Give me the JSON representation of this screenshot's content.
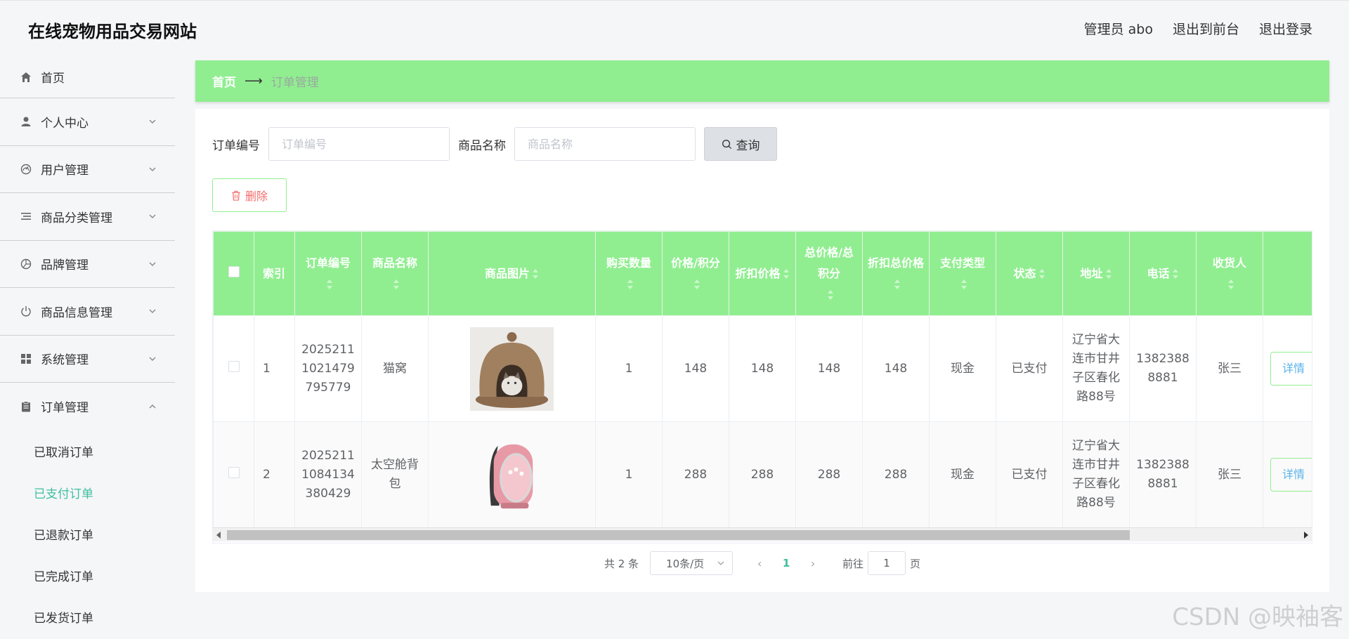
{
  "header": {
    "site_title": "在线宠物用品交易网站",
    "admin_label": "管理员 abo",
    "to_front_label": "退出到前台",
    "logout_label": "退出登录"
  },
  "sidebar": {
    "items": [
      {
        "label": "首页",
        "icon": "home-icon"
      },
      {
        "label": "个人中心",
        "icon": "user-icon"
      },
      {
        "label": "用户管理",
        "icon": "dashboard-icon"
      },
      {
        "label": "商品分类管理",
        "icon": "list-icon"
      },
      {
        "label": "品牌管理",
        "icon": "aperture-icon"
      },
      {
        "label": "商品信息管理",
        "icon": "power-icon"
      },
      {
        "label": "系统管理",
        "icon": "grid-icon"
      },
      {
        "label": "订单管理",
        "icon": "clipboard-icon"
      }
    ],
    "order_submenu": [
      "已取消订单",
      "已支付订单",
      "已退款订单",
      "已完成订单",
      "已发货订单"
    ],
    "active_submenu": "已支付订单"
  },
  "breadcrumb": {
    "home": "首页",
    "current": "订单管理"
  },
  "search": {
    "order_no_label": "订单编号",
    "order_no_placeholder": "订单编号",
    "product_name_label": "商品名称",
    "product_name_placeholder": "商品名称",
    "query_label": "查询",
    "delete_label": "删除"
  },
  "table": {
    "headers": [
      "索引",
      "订单编号",
      "商品名称",
      "商品图片",
      "购买数量",
      "价格/积分",
      "折扣价格",
      "总价格/总积分",
      "折扣总价格",
      "支付类型",
      "状态",
      "地址",
      "电话",
      "收货人",
      ""
    ],
    "rows": [
      {
        "index": "1",
        "order_no": "20252111021479795779",
        "product_name": "猫窝",
        "image": "cat-bed",
        "quantity": "1",
        "price": "148",
        "discount_price": "148",
        "total_price": "148",
        "discount_total": "148",
        "pay_type": "现金",
        "status": "已支付",
        "address": "辽宁省大连市甘井子区春化路88号",
        "phone": "13823888881",
        "receiver": "张三",
        "action": "详情"
      },
      {
        "index": "2",
        "order_no": "20252111084134380429",
        "product_name": "太空舱背包",
        "image": "pet-backpack",
        "quantity": "1",
        "price": "288",
        "discount_price": "288",
        "total_price": "288",
        "discount_total": "288",
        "pay_type": "现金",
        "status": "已支付",
        "address": "辽宁省大连市甘井子区春化路88号",
        "phone": "13823888881",
        "receiver": "张三",
        "action": "详情"
      }
    ]
  },
  "pagination": {
    "total_text": "共 2 条",
    "page_size": "10条/页",
    "current_page": "1",
    "goto_prefix": "前往",
    "goto_value": "1",
    "goto_suffix": "页"
  },
  "watermark": "CSDN @映袖客",
  "colors": {
    "accent_green": "#90ee90",
    "active_teal": "#3fbf9f",
    "danger": "#f56c6c"
  }
}
